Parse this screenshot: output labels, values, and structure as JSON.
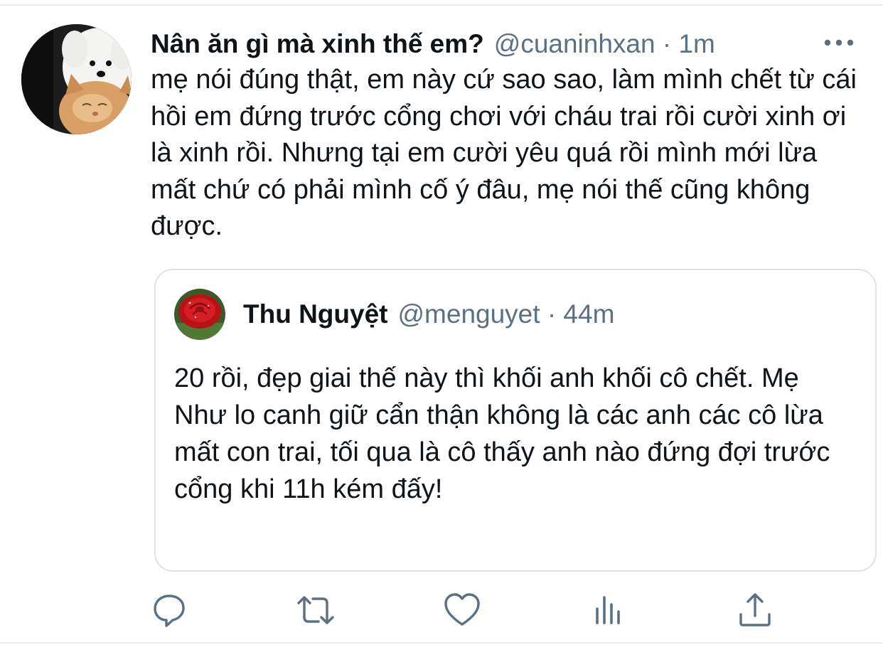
{
  "tweet": {
    "display_name": "Nân ăn gì mà xinh thế em?",
    "meta": "@cuaninhxan · 1m",
    "text": "mẹ nói đúng thật, em này cứ sao sao, làm mình chết từ cái hồi em đứng trước cổng chơi với cháu trai rồi cười xinh ơi là xinh rồi. Nhưng tại em cười yêu quá rồi mình mới lừa mất chứ có phải mình cố ý đâu, mẹ nói thế cũng không được."
  },
  "quote": {
    "display_name": "Thu Nguyệt",
    "meta": "@menguyet · 44m",
    "text": "20 rồi, đẹp giai thế này thì khối anh khối cô chết. Mẹ Như lo canh giữ cẩn thận không là các anh các cô lừa mất con trai, tối qua là cô thấy anh nào đứng đợi trước cổng khi 11h kém đấy!"
  },
  "icons": {
    "avatar": "avatar-white-dog-and-cat",
    "quote_avatar": "avatar-red-rose",
    "more": "more-horizontal-icon",
    "reply": "reply-icon",
    "retweet": "retweet-icon",
    "like": "heart-icon",
    "analytics": "analytics-icon",
    "share": "share-icon"
  },
  "colors": {
    "text": "#0f1419",
    "secondary": "#5b7083",
    "border": "#dde3e8"
  }
}
